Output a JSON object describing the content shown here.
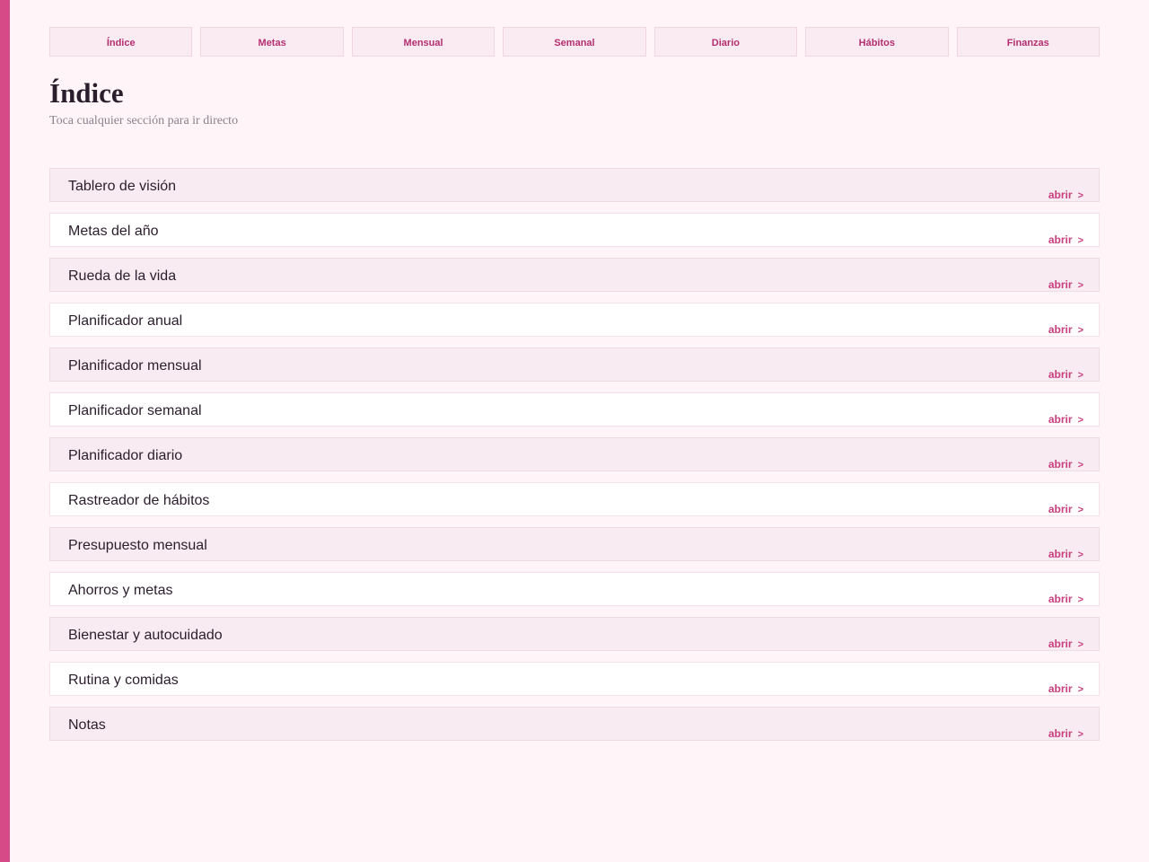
{
  "theme": {
    "accent": "#d64a87",
    "tab_text": "#b52f70",
    "link": "#c93f7f",
    "background": "#fff5f8"
  },
  "nav": {
    "tabs": [
      {
        "label": "Índice"
      },
      {
        "label": "Metas"
      },
      {
        "label": "Mensual"
      },
      {
        "label": "Semanal"
      },
      {
        "label": "Diario"
      },
      {
        "label": "Hábitos"
      },
      {
        "label": "Finanzas"
      }
    ]
  },
  "header": {
    "title": "Índice",
    "subtitle": "Toca cualquier sección para ir directo"
  },
  "sections": {
    "open_label": "abrir",
    "chevron_icon": "chevron-right-icon",
    "items": [
      {
        "name": "Tablero de visión"
      },
      {
        "name": "Metas del año"
      },
      {
        "name": "Rueda de la vida"
      },
      {
        "name": "Planificador anual"
      },
      {
        "name": "Planificador mensual"
      },
      {
        "name": "Planificador semanal"
      },
      {
        "name": "Planificador diario"
      },
      {
        "name": "Rastreador de hábitos"
      },
      {
        "name": "Presupuesto mensual"
      },
      {
        "name": "Ahorros y metas"
      },
      {
        "name": "Bienestar y autocuidado"
      },
      {
        "name": "Rutina y comidas"
      },
      {
        "name": "Notas"
      }
    ]
  }
}
